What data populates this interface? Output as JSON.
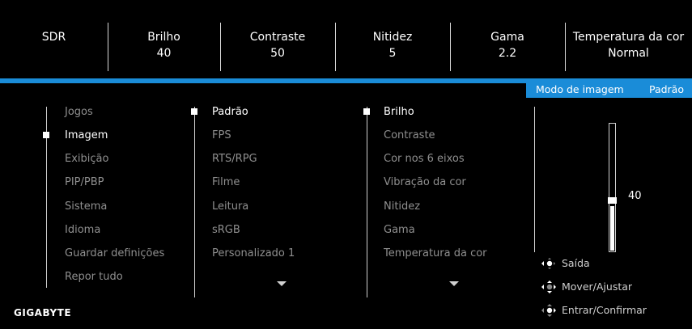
{
  "header": [
    {
      "title": "SDR",
      "value": ""
    },
    {
      "title": "Brilho",
      "value": "40"
    },
    {
      "title": "Contraste",
      "value": "50"
    },
    {
      "title": "Nitidez",
      "value": "5"
    },
    {
      "title": "Gama",
      "value": "2.2"
    },
    {
      "title": "Temperatura da cor",
      "value": "Normal"
    }
  ],
  "mode_bar": {
    "label": "Modo de imagem",
    "value": "Padrão"
  },
  "menu": {
    "col1": [
      "Jogos",
      "Imagem",
      "Exibição",
      "PIP/PBP",
      "Sistema",
      "Idioma",
      "Guardar definições",
      "Repor tudo"
    ],
    "col1_selected": "Imagem",
    "col2": [
      "Padrão",
      "FPS",
      "RTS/RPG",
      "Filme",
      "Leitura",
      "sRGB",
      "Personalizado 1"
    ],
    "col2_selected": "Padrão",
    "col3": [
      "Brilho",
      "Contraste",
      "Cor nos 6 eixos",
      "Vibração da cor",
      "Nitidez",
      "Gama",
      "Temperatura da cor"
    ],
    "col3_selected": "Brilho"
  },
  "slider": {
    "value": "40",
    "fraction": 0.4
  },
  "hints": [
    {
      "icon": "joystick-left-icon",
      "label": "Saída"
    },
    {
      "icon": "joystick-move-icon",
      "label": "Mover/Ajustar"
    },
    {
      "icon": "joystick-press-icon",
      "label": "Entrar/Confirmar"
    }
  ],
  "brand": "GIGABYTE",
  "colors": {
    "accent": "#1a8cd8",
    "selected": "#ffffff",
    "unselected": "#8f8f8f"
  }
}
